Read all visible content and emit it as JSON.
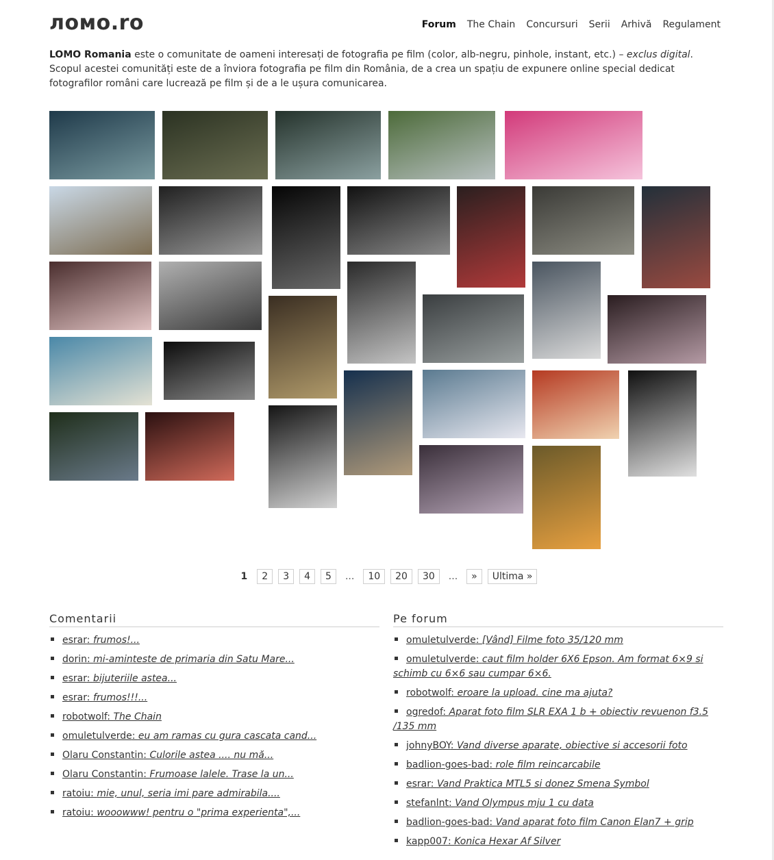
{
  "site": {
    "logo": "ломо.ro"
  },
  "nav": [
    {
      "label": "Forum",
      "active": true
    },
    {
      "label": "The Chain"
    },
    {
      "label": "Concursuri"
    },
    {
      "label": "Serii"
    },
    {
      "label": "Arhivă"
    },
    {
      "label": "Regulament"
    }
  ],
  "intro": {
    "brand": "LOMO Romania",
    "text1": " este o comunitate de oameni interesați de fotografia pe film (color, alb-negru, pinhole, instant, etc.) – ",
    "emph": "exclus digital",
    "text2": ". Scopul acestei comunități este de a înviora fotografia pe film din România, de a crea un spațiu de expunere online special dedicat fotografilor români care lucrează pe film și de a le ușura comunicarea."
  },
  "photos": [
    {
      "c1": "#1f3a4a",
      "c2": "#7a9aa0"
    },
    {
      "c1": "#2b3222",
      "c2": "#6b6e52"
    },
    {
      "c1": "#25332c",
      "c2": "#8ba0a0"
    },
    {
      "c1": "#4d6b3a",
      "c2": "#b7c0c0"
    },
    {
      "c1": "#d23a7a",
      "c2": "#f5c4dc"
    },
    {
      "c1": "#c9d8e6",
      "c2": "#7d6d52"
    },
    {
      "c1": "#202020",
      "c2": "#9a9a9a"
    },
    {
      "c1": "#050505",
      "c2": "#6a6a6a"
    },
    {
      "c1": "#111111",
      "c2": "#8a8a8a"
    },
    {
      "c1": "#2a1f1f",
      "c2": "#b23a3a"
    },
    {
      "c1": "#3a3a36",
      "c2": "#8e8e84"
    },
    {
      "c1": "#23303a",
      "c2": "#9a4a40"
    },
    {
      "c1": "#4a2e2e",
      "c2": "#e0c2c2"
    },
    {
      "c1": "#b0b0b0",
      "c2": "#3a3a3a"
    },
    {
      "c1": "#3a2e22",
      "c2": "#b09a6a"
    },
    {
      "c1": "#2a2a2a",
      "c2": "#c4c4c4"
    },
    {
      "c1": "#3a3e40",
      "c2": "#9aa0a0"
    },
    {
      "c1": "#4a5560",
      "c2": "#dadada"
    },
    {
      "c1": "#2a1d20",
      "c2": "#b49aa4"
    },
    {
      "c1": "#4a88a8",
      "c2": "#e4e2d4"
    },
    {
      "c1": "#0c0c0c",
      "c2": "#8a8a8a"
    },
    {
      "c1": "#15304e",
      "c2": "#b09a7a"
    },
    {
      "c1": "#5a7a90",
      "c2": "#e8e8f0"
    },
    {
      "c1": "#b53a22",
      "c2": "#f0d2b0"
    },
    {
      "c1": "#101010",
      "c2": "#e0e0e0"
    },
    {
      "c1": "#1f2e1a",
      "c2": "#6a7a8a"
    },
    {
      "c1": "#2a1010",
      "c2": "#d06a5a"
    },
    {
      "c1": "#151515",
      "c2": "#d2d2d2"
    },
    {
      "c1": "#3a2f3a",
      "c2": "#b7a6b8"
    },
    {
      "c1": "#6b5a2a",
      "c2": "#e7a040"
    }
  ],
  "pagination": {
    "current": "1",
    "pages": [
      "2",
      "3",
      "4",
      "5"
    ],
    "ellipsis": "...",
    "pages2": [
      "10",
      "20",
      "30"
    ],
    "next": "»",
    "last": "Ultima »"
  },
  "comments": {
    "title": "Comentarii",
    "items": [
      {
        "author": "esrar",
        "text": "frumos!..."
      },
      {
        "author": "dorin",
        "text": "mi-aminteste de primaria din Satu Mare..."
      },
      {
        "author": "esrar",
        "text": "bijuteriile astea..."
      },
      {
        "author": "esrar",
        "text": "frumos!!!..."
      },
      {
        "author": "robotwolf",
        "text": "The Chain"
      },
      {
        "author": "omuletulverde",
        "text": "eu am ramas cu gura cascata cand..."
      },
      {
        "author": "Olaru Constantin",
        "text": "Culorile astea .... nu mă..."
      },
      {
        "author": "Olaru Constantin",
        "text": "Frumoase lalele. Trase la un..."
      },
      {
        "author": "ratoiu",
        "text": "mie, unul, seria imi pare admirabila...."
      },
      {
        "author": "ratoiu",
        "text": "wooowww! pentru o \"prima experienta\",..."
      }
    ]
  },
  "forum": {
    "title": "Pe forum",
    "items": [
      {
        "author": "omuletulverde",
        "text": "[Vând] Filme foto 35/120 mm"
      },
      {
        "author": "omuletulverde",
        "text": "caut film holder 6X6 Epson. Am format 6×9 si schimb cu 6×6 sau cumpar 6×6."
      },
      {
        "author": "robotwolf",
        "text": "eroare la upload. cine ma ajuta?"
      },
      {
        "author": "ogredof",
        "text": "Aparat foto film SLR EXA 1 b + obiectiv revuenon f3.5 /135 mm"
      },
      {
        "author": "johnyBOY",
        "text": "Vand diverse aparate, obiective si accesorii foto"
      },
      {
        "author": "badlion-goes-bad",
        "text": "role film reincarcabile"
      },
      {
        "author": "esrar",
        "text": "Vand Praktica MTL5 si donez Smena Symbol"
      },
      {
        "author": "stefanlnt",
        "text": "Vand Olympus mju 1 cu data"
      },
      {
        "author": "badlion-goes-bad",
        "text": "Vand aparat foto film Canon Elan7 + grip"
      },
      {
        "author": "kapp007",
        "text": "Konica Hexar Af Silver"
      }
    ]
  }
}
